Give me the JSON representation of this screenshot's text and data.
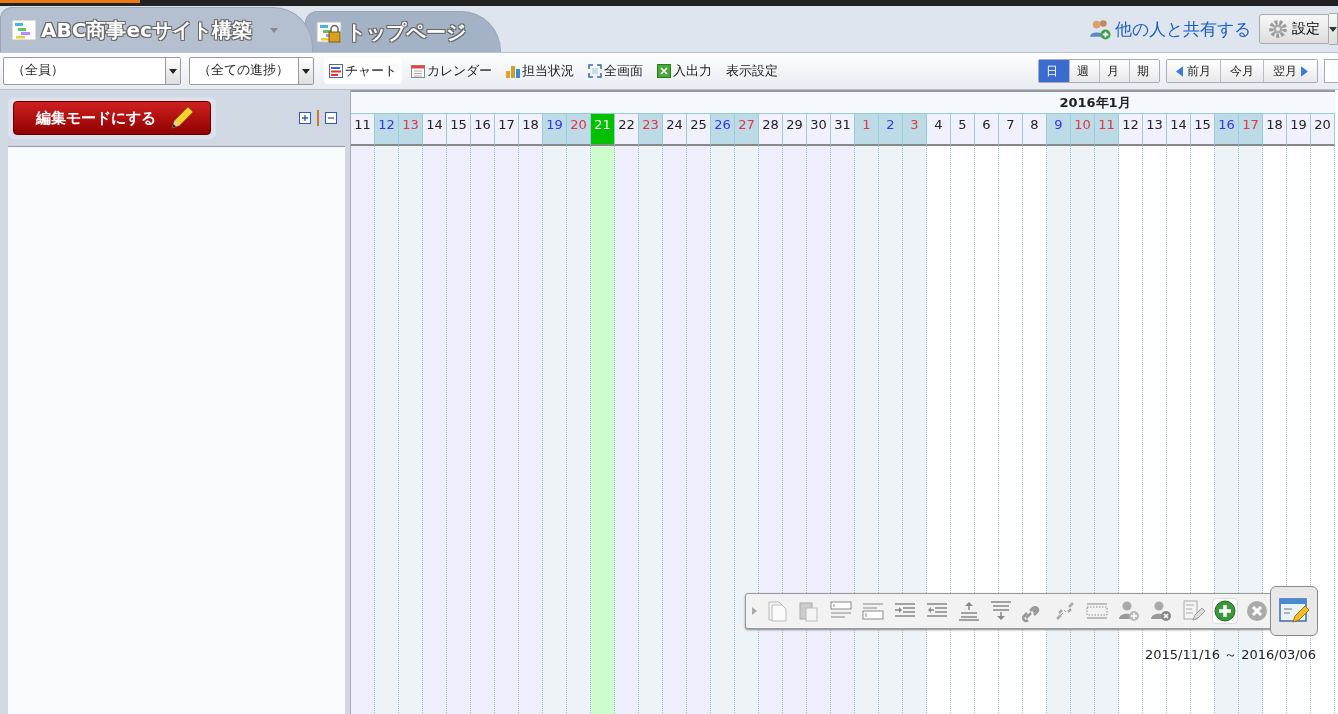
{
  "tabs": [
    {
      "label": "ABC商事ecサイト構築",
      "selected": true,
      "has_menu": true
    },
    {
      "label": "トップページ",
      "selected": false,
      "has_menu": false
    }
  ],
  "share_link": "他の人と共有する",
  "settings_button": "設定",
  "filters": [
    {
      "value": "（全員）"
    },
    {
      "value": "（全ての進捗）"
    }
  ],
  "view_tabs": [
    {
      "label": "チャート",
      "selected": true
    },
    {
      "label": "カレンダー",
      "selected": false
    },
    {
      "label": "担当状況",
      "selected": false
    },
    {
      "label": "全画面",
      "selected": false
    },
    {
      "label": "入出力",
      "selected": false
    },
    {
      "label": "表示設定",
      "selected": false
    }
  ],
  "scale_buttons": [
    {
      "label": "日",
      "selected": true
    },
    {
      "label": "週",
      "selected": false
    },
    {
      "label": "月",
      "selected": false
    },
    {
      "label": "期",
      "selected": false
    }
  ],
  "nav_buttons": [
    {
      "label": "前月",
      "kind": "prev"
    },
    {
      "label": "今月",
      "kind": "plain"
    },
    {
      "label": "翌月",
      "kind": "next"
    }
  ],
  "edit_mode_button": "編集モードにする",
  "calendar": {
    "months": [
      {
        "in_range": false,
        "days": [
          {
            "label": "11",
            "kind": "weekday"
          },
          {
            "label": "12",
            "kind": "saturday"
          },
          {
            "label": "13",
            "kind": "holiday"
          },
          {
            "label": "14",
            "kind": "weekday"
          },
          {
            "label": "15",
            "kind": "weekday"
          },
          {
            "label": "16",
            "kind": "weekday"
          },
          {
            "label": "17",
            "kind": "weekday"
          },
          {
            "label": "18",
            "kind": "weekday"
          },
          {
            "label": "19",
            "kind": "saturday"
          },
          {
            "label": "20",
            "kind": "holiday"
          },
          {
            "label": "21",
            "kind": "today"
          },
          {
            "label": "22",
            "kind": "weekday"
          },
          {
            "label": "23",
            "kind": "holiday"
          },
          {
            "label": "24",
            "kind": "weekday"
          },
          {
            "label": "25",
            "kind": "weekday"
          },
          {
            "label": "26",
            "kind": "saturday"
          },
          {
            "label": "27",
            "kind": "holiday"
          },
          {
            "label": "28",
            "kind": "weekday"
          },
          {
            "label": "29",
            "kind": "weekday"
          },
          {
            "label": "30",
            "kind": "weekday"
          },
          {
            "label": "31",
            "kind": "weekday"
          }
        ]
      },
      {
        "title": "2016年1月",
        "in_range": true,
        "days": [
          {
            "label": "1",
            "kind": "holiday"
          },
          {
            "label": "2",
            "kind": "saturday"
          },
          {
            "label": "3",
            "kind": "holiday"
          },
          {
            "label": "4",
            "kind": "weekday"
          },
          {
            "label": "5",
            "kind": "weekday"
          },
          {
            "label": "6",
            "kind": "weekday"
          },
          {
            "label": "7",
            "kind": "weekday"
          },
          {
            "label": "8",
            "kind": "weekday"
          },
          {
            "label": "9",
            "kind": "saturday"
          },
          {
            "label": "10",
            "kind": "holiday"
          },
          {
            "label": "11",
            "kind": "holiday"
          },
          {
            "label": "12",
            "kind": "weekday"
          },
          {
            "label": "13",
            "kind": "weekday"
          },
          {
            "label": "14",
            "kind": "weekday"
          },
          {
            "label": "15",
            "kind": "weekday"
          },
          {
            "label": "16",
            "kind": "saturday"
          },
          {
            "label": "17",
            "kind": "holiday"
          },
          {
            "label": "18",
            "kind": "weekday"
          },
          {
            "label": "19",
            "kind": "weekday"
          },
          {
            "label": "20",
            "kind": "weekday"
          }
        ]
      }
    ]
  },
  "date_range": "2015/11/16 ～ 2016/03/06"
}
